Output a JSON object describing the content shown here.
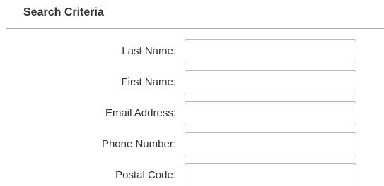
{
  "section": {
    "title": "Search Criteria"
  },
  "fields": [
    {
      "label": "Last Name:",
      "value": "",
      "placeholder": ""
    },
    {
      "label": "First Name:",
      "value": "",
      "placeholder": ""
    },
    {
      "label": "Email Address:",
      "value": "",
      "placeholder": ""
    },
    {
      "label": "Phone Number:",
      "value": "",
      "placeholder": ""
    },
    {
      "label": "Postal Code:",
      "value": "",
      "placeholder": ""
    }
  ],
  "colors": {
    "text": "#333333",
    "divider": "#a9a9a9",
    "input_border": "#b9b9b9",
    "background": "#ffffff"
  }
}
